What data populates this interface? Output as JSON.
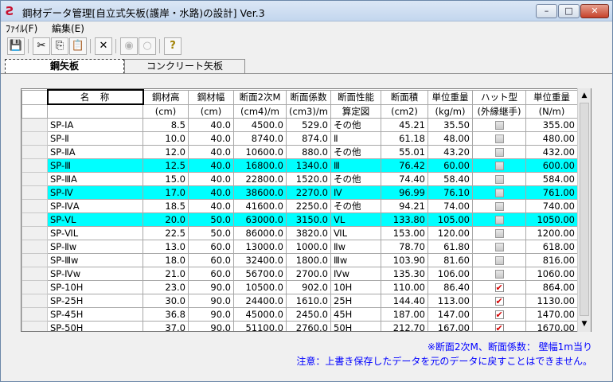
{
  "window": {
    "title": "鋼材データ管理[自立式矢板(護岸・水路)の設計] Ver.3",
    "min_glyph": "–",
    "max_glyph": "□",
    "close_glyph": "✕"
  },
  "menu": {
    "file": "ﾌｧｲﾙ(F)",
    "edit": "編集(E)"
  },
  "toolbar": {
    "save": "💾",
    "cut": "✂",
    "copy": "⎘",
    "paste": "📋",
    "delete": "✕",
    "radio_on": "◉",
    "radio_off": "○",
    "help": "?"
  },
  "tabs": {
    "active": "鋼矢板",
    "inactive": "コンクリート矢板"
  },
  "columns": {
    "row1": [
      "名　称",
      "鋼材高",
      "鋼材幅",
      "断面2次M",
      "断面係数",
      "断面性能",
      "断面積",
      "単位重量",
      "ハット型",
      "単位重量"
    ],
    "row2": [
      "",
      "(cm)",
      "(cm)",
      "(cm4)/m",
      "(cm3)/m",
      "算定図",
      "(cm2)",
      "(kg/m)",
      "(外縁継手)",
      "(N/m)"
    ]
  },
  "rows": [
    {
      "name": "SP-ⅠA",
      "h": "8.5",
      "w": "40.0",
      "m2": "4500.0",
      "z": "529.0",
      "perf": "その他",
      "area": "45.21",
      "kgm": "35.50",
      "hat": false,
      "nm": "355.00",
      "hl": false
    },
    {
      "name": "SP-Ⅱ",
      "h": "10.0",
      "w": "40.0",
      "m2": "8740.0",
      "z": "874.0",
      "perf": "Ⅱ",
      "area": "61.18",
      "kgm": "48.00",
      "hat": false,
      "nm": "480.00",
      "hl": false
    },
    {
      "name": "SP-ⅡA",
      "h": "12.0",
      "w": "40.0",
      "m2": "10600.0",
      "z": "880.0",
      "perf": "その他",
      "area": "55.01",
      "kgm": "43.20",
      "hat": false,
      "nm": "432.00",
      "hl": false
    },
    {
      "name": "SP-Ⅲ",
      "h": "12.5",
      "w": "40.0",
      "m2": "16800.0",
      "z": "1340.0",
      "perf": "Ⅲ",
      "area": "76.42",
      "kgm": "60.00",
      "hat": false,
      "nm": "600.00",
      "hl": true
    },
    {
      "name": "SP-ⅢA",
      "h": "15.0",
      "w": "40.0",
      "m2": "22800.0",
      "z": "1520.0",
      "perf": "その他",
      "area": "74.40",
      "kgm": "58.40",
      "hat": false,
      "nm": "584.00",
      "hl": false
    },
    {
      "name": "SP-Ⅳ",
      "h": "17.0",
      "w": "40.0",
      "m2": "38600.0",
      "z": "2270.0",
      "perf": "Ⅳ",
      "area": "96.99",
      "kgm": "76.10",
      "hat": false,
      "nm": "761.00",
      "hl": true
    },
    {
      "name": "SP-ⅣA",
      "h": "18.5",
      "w": "40.0",
      "m2": "41600.0",
      "z": "2250.0",
      "perf": "その他",
      "area": "94.21",
      "kgm": "74.00",
      "hat": false,
      "nm": "740.00",
      "hl": false
    },
    {
      "name": "SP-ⅤL",
      "h": "20.0",
      "w": "50.0",
      "m2": "63000.0",
      "z": "3150.0",
      "perf": "ⅤL",
      "area": "133.80",
      "kgm": "105.00",
      "hat": false,
      "nm": "1050.00",
      "hl": true
    },
    {
      "name": "SP-ⅥL",
      "h": "22.5",
      "w": "50.0",
      "m2": "86000.0",
      "z": "3820.0",
      "perf": "ⅥL",
      "area": "153.00",
      "kgm": "120.00",
      "hat": false,
      "nm": "1200.00",
      "hl": false
    },
    {
      "name": "SP-Ⅱw",
      "h": "13.0",
      "w": "60.0",
      "m2": "13000.0",
      "z": "1000.0",
      "perf": "Ⅱw",
      "area": "78.70",
      "kgm": "61.80",
      "hat": false,
      "nm": "618.00",
      "hl": false
    },
    {
      "name": "SP-Ⅲw",
      "h": "18.0",
      "w": "60.0",
      "m2": "32400.0",
      "z": "1800.0",
      "perf": "Ⅲw",
      "area": "103.90",
      "kgm": "81.60",
      "hat": false,
      "nm": "816.00",
      "hl": false
    },
    {
      "name": "SP-Ⅳw",
      "h": "21.0",
      "w": "60.0",
      "m2": "56700.0",
      "z": "2700.0",
      "perf": "Ⅳw",
      "area": "135.30",
      "kgm": "106.00",
      "hat": false,
      "nm": "1060.00",
      "hl": false
    },
    {
      "name": "SP-10H",
      "h": "23.0",
      "w": "90.0",
      "m2": "10500.0",
      "z": "902.0",
      "perf": "10H",
      "area": "110.00",
      "kgm": "86.40",
      "hat": true,
      "nm": "864.00",
      "hl": false
    },
    {
      "name": "SP-25H",
      "h": "30.0",
      "w": "90.0",
      "m2": "24400.0",
      "z": "1610.0",
      "perf": "25H",
      "area": "144.40",
      "kgm": "113.00",
      "hat": true,
      "nm": "1130.00",
      "hl": false
    },
    {
      "name": "SP-45H",
      "h": "36.8",
      "w": "90.0",
      "m2": "45000.0",
      "z": "2450.0",
      "perf": "45H",
      "area": "187.00",
      "kgm": "147.00",
      "hat": true,
      "nm": "1470.00",
      "hl": false
    },
    {
      "name": "SP-50H",
      "h": "37.0",
      "w": "90.0",
      "m2": "51100.0",
      "z": "2760.0",
      "perf": "50H",
      "area": "212.70",
      "kgm": "167.00",
      "hat": true,
      "nm": "1670.00",
      "hl": false
    }
  ],
  "notes": {
    "line1": "※断面2次M、断面係数： 壁幅1m当り",
    "line2": "注意：上書き保存したデータを元のデータに戻すことはできません。"
  },
  "check_glyph": "✔"
}
